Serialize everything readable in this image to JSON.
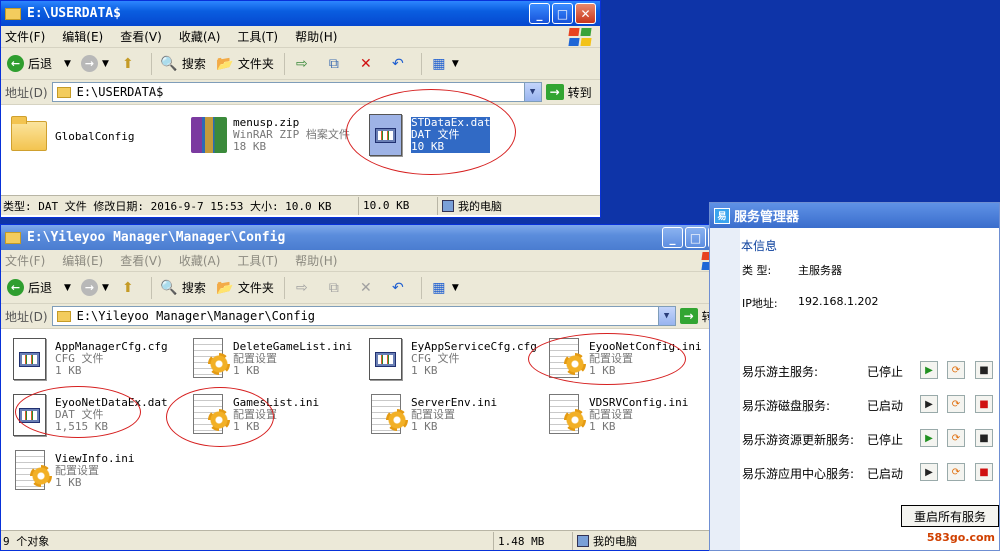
{
  "colors": {
    "desktop": "#0e34a8",
    "title_blue": "#0a5ee0",
    "chrome": "#ece9d8",
    "select": "#316ac5",
    "ellipse": "#d62020"
  },
  "menus": [
    "文件(F)",
    "编辑(E)",
    "查看(V)",
    "收藏(A)",
    "工具(T)",
    "帮助(H)"
  ],
  "toolbar": {
    "back": "后退",
    "search": "搜索",
    "folders": "文件夹",
    "back_icon": "back-arrow-icon",
    "forward_icon": "forward-arrow-icon"
  },
  "address": {
    "label": "地址(D)",
    "go": "转到"
  },
  "window1": {
    "title": "E:\\USERDATA$",
    "path": "E:\\USERDATA$",
    "items": [
      {
        "name": "GlobalConfig",
        "type": "",
        "size": "",
        "icon": "folder-icon"
      },
      {
        "name": "menusp.zip",
        "type": "WinRAR ZIP 档案文件",
        "size": "18 KB",
        "icon": "winrar-icon"
      },
      {
        "name": "STDataEx.dat",
        "type": "DAT 文件",
        "size": "10 KB",
        "icon": "dat-file-icon",
        "selected": true
      }
    ],
    "status": {
      "info": "类型: DAT 文件 修改日期: 2016-9-7 15:53 大小: 10.0 KB",
      "size": "10.0 KB",
      "location": "我的电脑"
    }
  },
  "window2": {
    "title": "E:\\Yileyoo Manager\\Manager\\Config",
    "path": "E:\\Yileyoo Manager\\Manager\\Config",
    "items": [
      {
        "name": "AppManagerCfg.cfg",
        "type": "CFG 文件",
        "size": "1 KB",
        "icon": "cfg-file-icon"
      },
      {
        "name": "DeleteGameList.ini",
        "type": "配置设置",
        "size": "1 KB",
        "icon": "ini-file-icon"
      },
      {
        "name": "EyAppServiceCfg.cfg",
        "type": "CFG 文件",
        "size": "1 KB",
        "icon": "cfg-file-icon"
      },
      {
        "name": "EyooNetConfig.ini",
        "type": "配置设置",
        "size": "1 KB",
        "icon": "ini-file-icon"
      },
      {
        "name": "EyooNetDataEx.dat",
        "type": "DAT 文件",
        "size": "1,515 KB",
        "icon": "dat-file-icon"
      },
      {
        "name": "GamesList.ini",
        "type": "配置设置",
        "size": "1 KB",
        "icon": "ini-file-icon"
      },
      {
        "name": "ServerEnv.ini",
        "type": "配置设置",
        "size": "1 KB",
        "icon": "ini-file-icon"
      },
      {
        "name": "VDSRVConfig.ini",
        "type": "配置设置",
        "size": "1 KB",
        "icon": "ini-file-icon"
      },
      {
        "name": "ViewInfo.ini",
        "type": "配置设置",
        "size": "1 KB",
        "icon": "ini-file-icon"
      }
    ],
    "status": {
      "count": "9 个对象",
      "size": "1.48 MB",
      "location": "我的电脑"
    }
  },
  "service_manager": {
    "title": "服务管理器",
    "section": "本信息",
    "type_label": "类 型:",
    "type_value": "主服务器",
    "ip_label": "IP地址:",
    "ip_value": "192.168.1.202",
    "services": [
      {
        "name": "易乐游主服务:",
        "status": "已停止"
      },
      {
        "name": "易乐游磁盘服务:",
        "status": "已启动"
      },
      {
        "name": "易乐游资源更新服务:",
        "status": "已停止"
      },
      {
        "name": "易乐游应用中心服务:",
        "status": "已启动"
      }
    ],
    "restart_all": "重启所有服务"
  },
  "watermark": "583go.com"
}
